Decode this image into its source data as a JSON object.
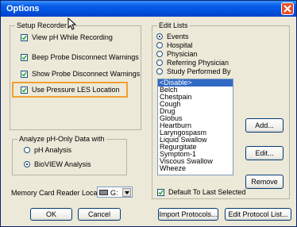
{
  "window": {
    "title": "Options"
  },
  "setup_recorder": {
    "label": "Setup Recorder",
    "options": [
      {
        "label": "View pH While Recording",
        "checked": true
      },
      {
        "label": "Beep Probe Disconnect Warnings",
        "checked": true
      },
      {
        "label": "Show Probe Disconnect Warnings",
        "checked": true
      },
      {
        "label": "Use Pressure LES Location",
        "checked": true
      }
    ],
    "highlight_color": "#f0a030"
  },
  "analyze": {
    "label": "Analyze pH-Only Data with",
    "options": [
      {
        "label": "pH Analysis",
        "selected": false
      },
      {
        "label": "BioVIEW Analysis",
        "selected": true
      }
    ]
  },
  "memory_card": {
    "label": "Memory Card Reader Location:",
    "value": "G:",
    "icon": "drive-icon"
  },
  "buttons": {
    "ok": "OK",
    "cancel": "Cancel",
    "import": "Import Protocols...",
    "edit_protocol": "Edit Protocol List..."
  },
  "edit_lists": {
    "label": "Edit Lists",
    "radios": [
      {
        "label": "Events",
        "selected": true
      },
      {
        "label": "Hospital",
        "selected": false
      },
      {
        "label": "Physician",
        "selected": false
      },
      {
        "label": "Referring Physician",
        "selected": false
      },
      {
        "label": "Study Performed By",
        "selected": false
      }
    ],
    "items": [
      "<Disable>",
      "Belch",
      "Chestpain",
      "Cough",
      "Drug",
      "Globus",
      "Heartburn",
      "Laryngospasm",
      "Liquid Swallow",
      "Regurgitate",
      "Symptom-1",
      "Viscous Swallow",
      "Wheeze"
    ],
    "selected_index": 0,
    "add": "Add...",
    "edit": "Edit...",
    "remove": "Remove",
    "default_label": "Default To Last Selected",
    "default_checked": true
  },
  "colors": {
    "titlebar": "#0054e3",
    "dialog": "#ece9d8",
    "selection": "#316ac5",
    "close": "#e5502b"
  }
}
